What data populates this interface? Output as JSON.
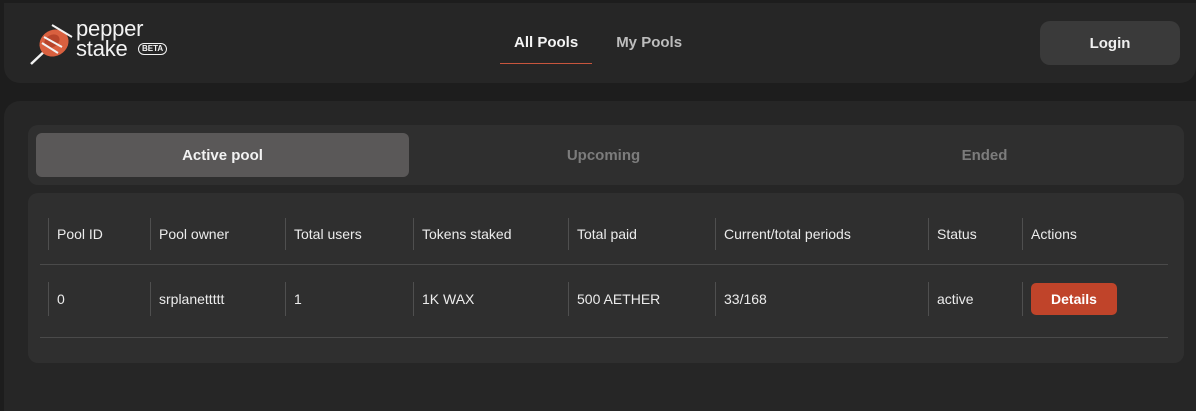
{
  "brand": {
    "line1": "pepper",
    "line2": "stake",
    "badge": "BETA"
  },
  "nav": {
    "all_pools": "All Pools",
    "my_pools": "My Pools"
  },
  "header": {
    "login_label": "Login"
  },
  "tabs": {
    "active": "Active pool",
    "upcoming": "Upcoming",
    "ended": "Ended"
  },
  "table": {
    "columns": [
      "Pool ID",
      "Pool owner",
      "Total users",
      "Tokens staked",
      "Total paid",
      "Current/total periods",
      "Status",
      "Actions"
    ],
    "rows": [
      {
        "pool_id": "0",
        "owner": "srplanettttt",
        "users": "1",
        "staked": "1K WAX",
        "paid": "500 AETHER",
        "periods": "33/168",
        "status": "active",
        "action": "Details"
      }
    ]
  },
  "colors": {
    "accent": "#c0442a",
    "bg": "#1d1d1d",
    "panel": "#262626"
  }
}
